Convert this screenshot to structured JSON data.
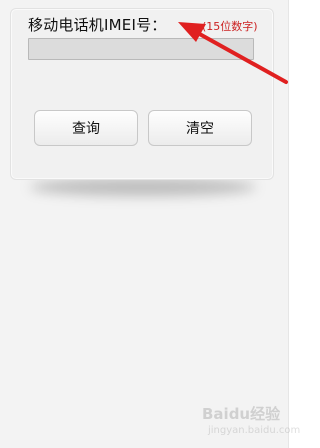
{
  "form": {
    "label": "移动电话机IMEI号：",
    "hint": "(15位数字)",
    "imei_value": ""
  },
  "buttons": {
    "query_label": "查询",
    "clear_label": "清空"
  },
  "annotation": {
    "arrow_color": "#e02020"
  },
  "watermark": {
    "text": "Baidu经验",
    "subtext": "jingyan.baidu.com"
  },
  "colors": {
    "page_background": "#f3f3f3",
    "card_background": "#f1f1f1",
    "hint_text": "#cc2222",
    "input_background": "#dcdcdc"
  }
}
